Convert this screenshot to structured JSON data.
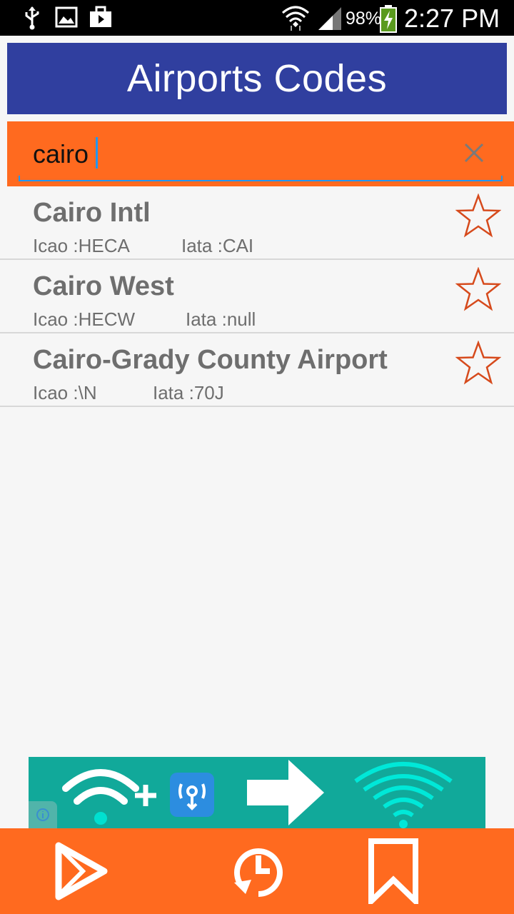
{
  "status_bar": {
    "battery_percent": "98%",
    "time": "2:27 PM",
    "icons": [
      "usb-icon",
      "image-icon",
      "briefcase-icon",
      "wifi-icon",
      "signal-icon",
      "battery-icon"
    ]
  },
  "header": {
    "title": "Airports Codes"
  },
  "search": {
    "value": "cairo",
    "clear_icon": "close-icon"
  },
  "results": [
    {
      "name": "Cairo Intl",
      "icao": "Icao :HECA",
      "iata": "Iata :CAI",
      "favorite_icon": "star-outline-icon"
    },
    {
      "name": "Cairo West",
      "icao": "Icao :HECW",
      "iata": "Iata :null",
      "favorite_icon": "star-outline-icon"
    },
    {
      "name": "Cairo-Grady County Airport",
      "icao": "Icao :\\N",
      "iata": "Iata :70J",
      "favorite_icon": "star-outline-icon"
    }
  ],
  "ad": {
    "icons": [
      "wifi-icon",
      "plus-icon",
      "wifi-app-icon",
      "arrow-right-icon",
      "wifi-icon",
      "info-icon"
    ]
  },
  "bottom_nav": {
    "icons": [
      "play-store-icon",
      "history-icon",
      "bookmark-icon"
    ]
  },
  "colors": {
    "header_bg": "#303f9f",
    "accent": "#ff6a1f",
    "star": "#d64a1c",
    "text_gray": "#6e6e6e",
    "ad_bg": "#11a99a"
  }
}
